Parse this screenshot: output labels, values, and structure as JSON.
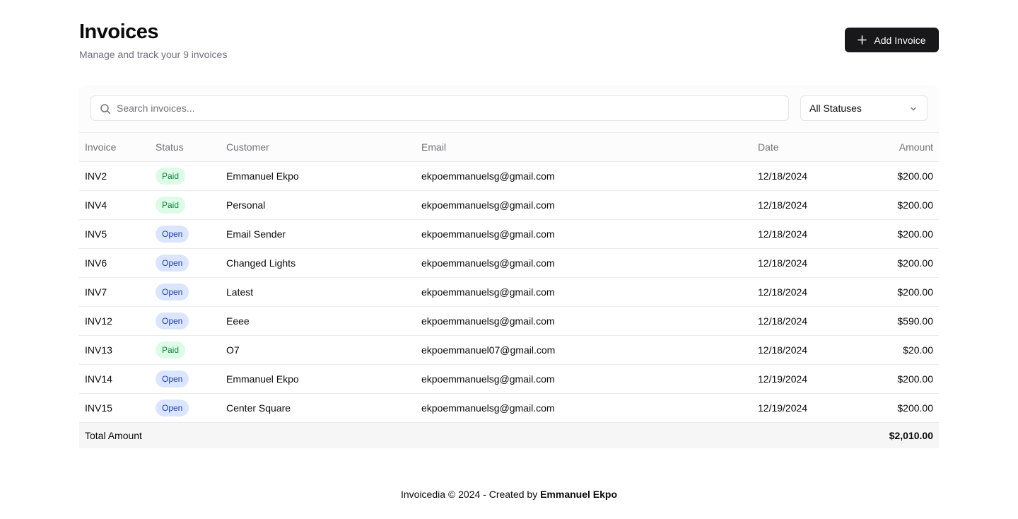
{
  "header": {
    "title": "Invoices",
    "subtitle": "Manage and track your 9 invoices",
    "add_label": "Add Invoice"
  },
  "search": {
    "placeholder": "Search invoices..."
  },
  "status_filter": {
    "selected": "All Statuses"
  },
  "table": {
    "columns": [
      "Invoice",
      "Status",
      "Customer",
      "Email",
      "Date",
      "Amount"
    ],
    "rows": [
      {
        "invoice": "INV2",
        "status": "Paid",
        "customer": "Emmanuel Ekpo",
        "email": "ekpoemmanuelsg@gmail.com",
        "date": "12/18/2024",
        "amount": "$200.00"
      },
      {
        "invoice": "INV4",
        "status": "Paid",
        "customer": "Personal",
        "email": "ekpoemmanuelsg@gmail.com",
        "date": "12/18/2024",
        "amount": "$200.00"
      },
      {
        "invoice": "INV5",
        "status": "Open",
        "customer": "Email Sender",
        "email": "ekpoemmanuelsg@gmail.com",
        "date": "12/18/2024",
        "amount": "$200.00"
      },
      {
        "invoice": "INV6",
        "status": "Open",
        "customer": "Changed Lights",
        "email": "ekpoemmanuelsg@gmail.com",
        "date": "12/18/2024",
        "amount": "$200.00"
      },
      {
        "invoice": "INV7",
        "status": "Open",
        "customer": "Latest",
        "email": "ekpoemmanuelsg@gmail.com",
        "date": "12/18/2024",
        "amount": "$200.00"
      },
      {
        "invoice": "INV12",
        "status": "Open",
        "customer": "Eeee",
        "email": "ekpoemmanuelsg@gmail.com",
        "date": "12/18/2024",
        "amount": "$590.00"
      },
      {
        "invoice": "INV13",
        "status": "Paid",
        "customer": "O7",
        "email": "ekpoemmanuel07@gmail.com",
        "date": "12/18/2024",
        "amount": "$20.00"
      },
      {
        "invoice": "INV14",
        "status": "Open",
        "customer": "Emmanuel Ekpo",
        "email": "ekpoemmanuelsg@gmail.com",
        "date": "12/19/2024",
        "amount": "$200.00"
      },
      {
        "invoice": "INV15",
        "status": "Open",
        "customer": "Center Square",
        "email": "ekpoemmanuelsg@gmail.com",
        "date": "12/19/2024",
        "amount": "$200.00"
      }
    ],
    "total_label": "Total Amount",
    "total_value": "$2,010.00"
  },
  "footer": {
    "prefix": "Invoicedia © 2024 - Created by",
    "author": "Emmanuel Ekpo"
  },
  "icons": {
    "add": "plus-icon",
    "search": "search-icon",
    "select": "chevron-down-icon"
  },
  "colors": {
    "primary": "#18181b",
    "paid_bg": "#dcfce7",
    "paid_text": "#15803d",
    "open_bg": "#dbe6fe",
    "open_text": "#1e40af"
  }
}
